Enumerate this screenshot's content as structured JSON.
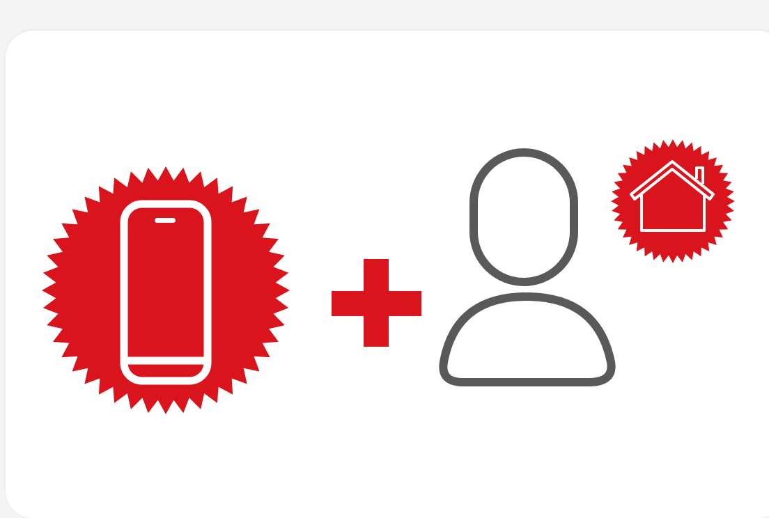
{
  "colors": {
    "background": "#f4f4f4",
    "card": "#ffffff",
    "accent_red": "#da141c",
    "icon_gray": "#595959",
    "icon_white": "#ffffff"
  },
  "illustration": {
    "badge_left_icon": "smartphone-icon",
    "operator_icon": "plus-icon",
    "person_icon": "user-icon",
    "badge_right_icon": "house-icon"
  }
}
